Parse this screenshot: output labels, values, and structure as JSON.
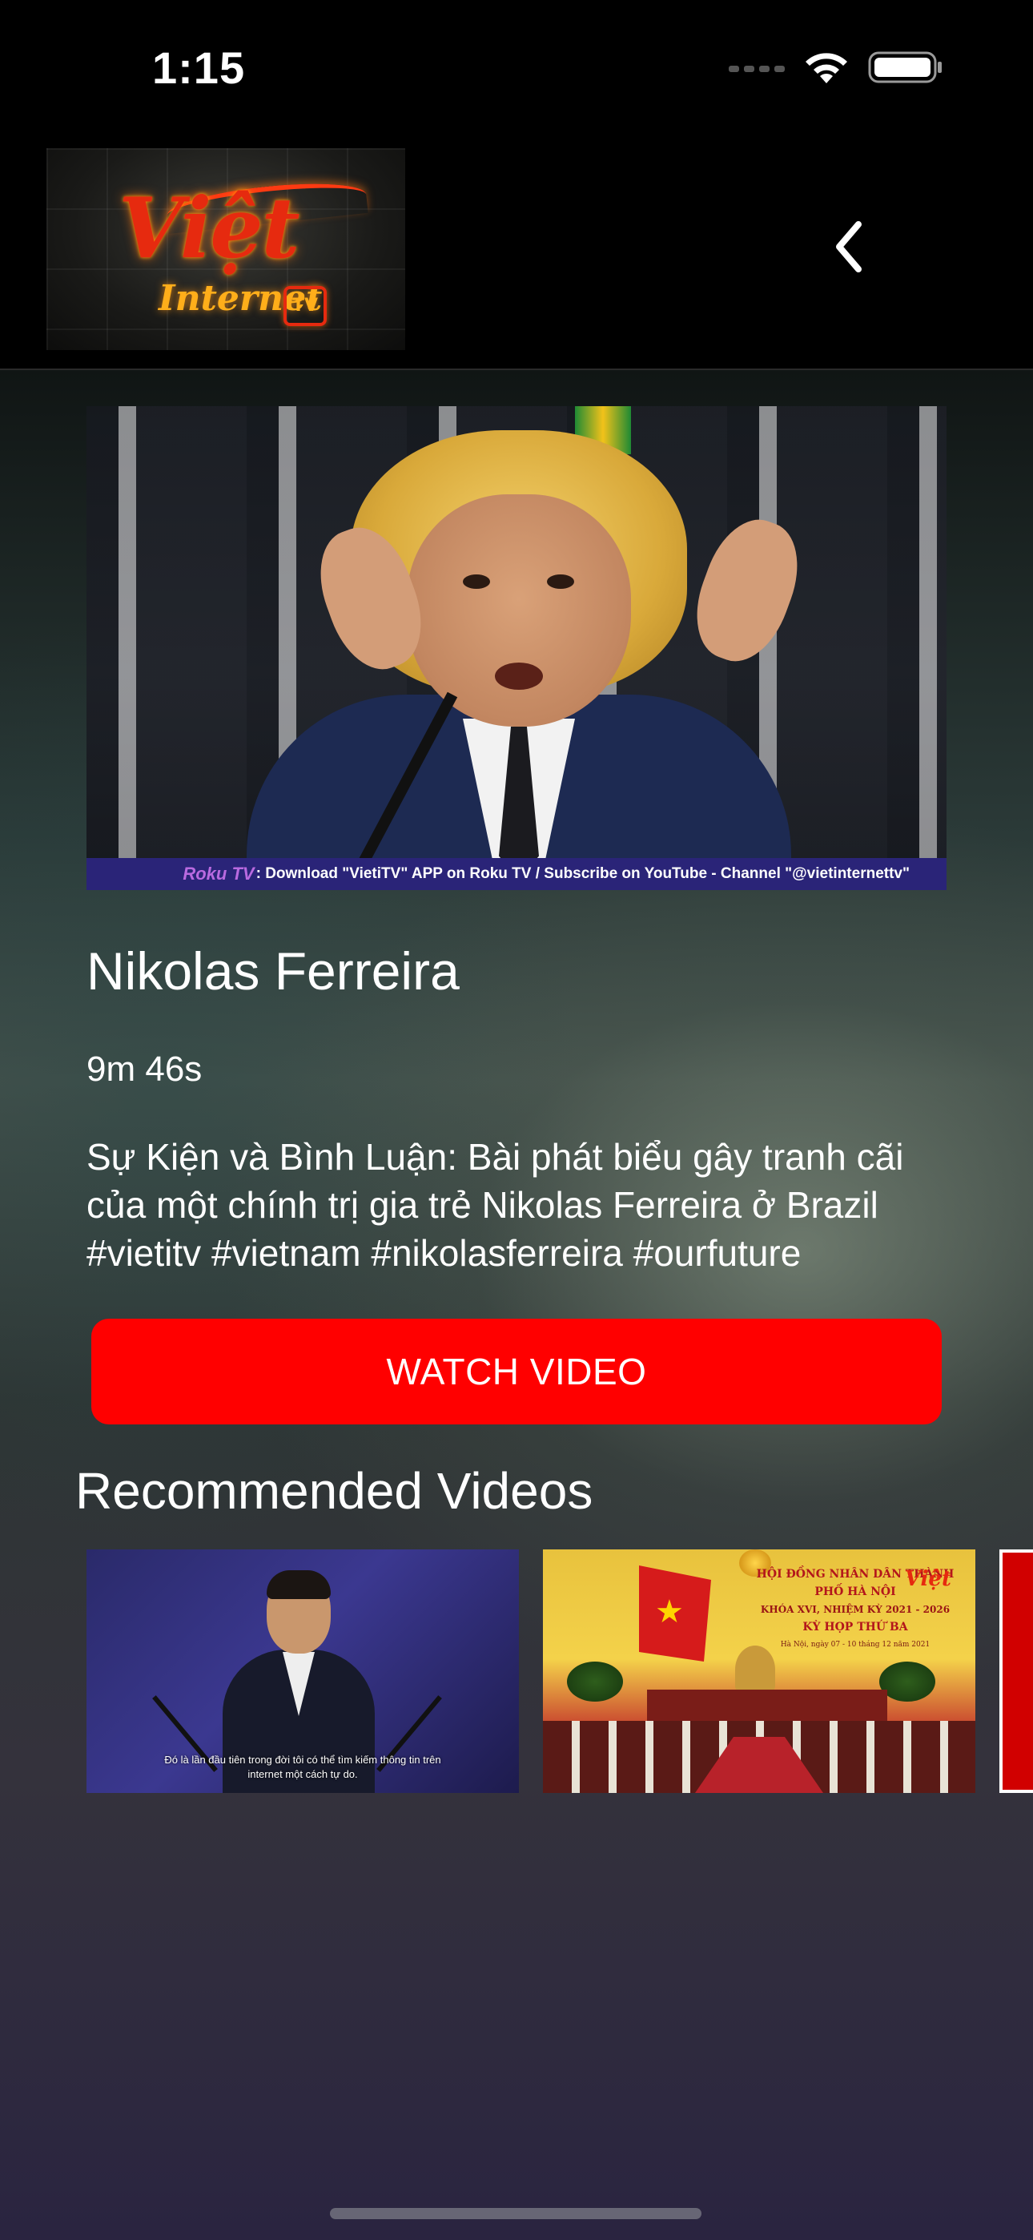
{
  "status_bar": {
    "time": "1:15",
    "icons": [
      "signal-icon",
      "wifi-icon",
      "battery-icon"
    ]
  },
  "header": {
    "logo_text": "Việt",
    "logo_subtext": "Internet",
    "logo_badge": "TV",
    "back_icon": "chevron-left-icon"
  },
  "featured": {
    "thumbnail_banner_brand": "Roku TV",
    "thumbnail_banner_text": ": Download \"VietiTV\" APP on Roku TV / Subscribe on YouTube - Channel \"@vietinternettv\"",
    "title": "Nikolas Ferreira",
    "duration": "9m 46s",
    "description": "Sự Kiện và Bình Luận: Bài phát biểu gây tranh cãi của một chính trị gia trẻ Nikolas Ferreira ở Brazil #vietitv #vietnam #nikolasferreira #ourfuture",
    "watch_label": "WATCH VIDEO"
  },
  "recommended": {
    "section_title": "Recommended Videos",
    "items": [
      {
        "subtitle_line1": "Đó là lần đầu tiên trong đời tôi có thể tìm kiếm thông tin trên",
        "subtitle_line2": "internet một cách tự do."
      },
      {
        "header_line1": "HỘI ĐỒNG NHÂN DÂN THÀNH PHỐ HÀ NỘI",
        "header_line2": "KHÓA XVI, NHIỆM KỲ 2021 - 2026",
        "header_line3": "KỲ HỌP THỨ BA",
        "header_date": "Hà Nội, ngày 07 - 10 tháng 12 năm 2021",
        "logo_text": "Việt"
      },
      {}
    ]
  },
  "colors": {
    "accent": "#ff0000",
    "background": "#000000",
    "text": "#ffffff"
  }
}
